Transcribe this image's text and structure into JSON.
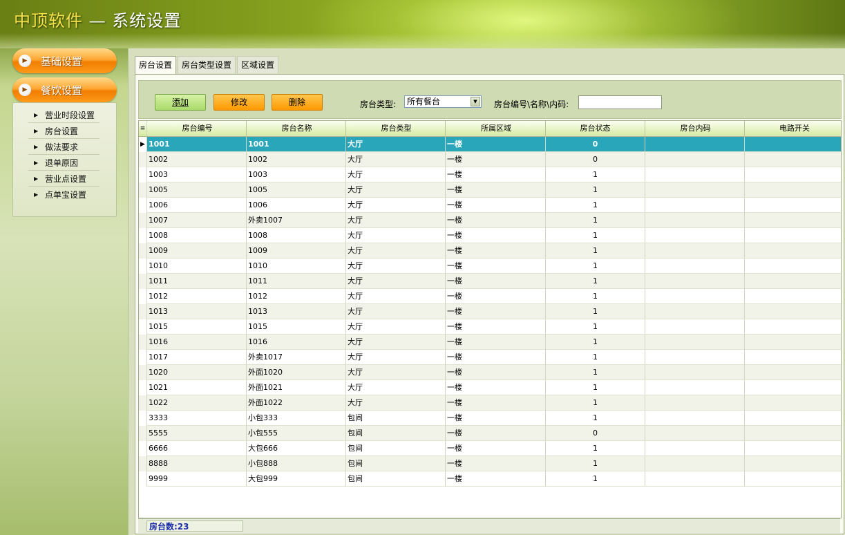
{
  "window": {
    "brand": "中顶软件",
    "title_suffix": " — 系统设置"
  },
  "sidebar": {
    "sections": [
      {
        "label": "基础设置"
      },
      {
        "label": "餐饮设置"
      }
    ],
    "items": [
      "营业时段设置",
      "房台设置",
      "做法要求",
      "退单原因",
      "营业点设置",
      "点单宝设置"
    ]
  },
  "tabs": [
    "房台设置",
    "房台类型设置",
    "区域设置"
  ],
  "toolbar": {
    "add_label": "添加",
    "edit_label": "修改",
    "delete_label": "删除",
    "type_label": "房台类型:",
    "type_value": "所有餐台",
    "search_label": "房台编号\\名称\\内码:",
    "search_value": ""
  },
  "grid": {
    "columns": [
      "房台编号",
      "房台名称",
      "房台类型",
      "所属区域",
      "房台状态",
      "房台内码",
      "电路开关"
    ],
    "rows": [
      [
        "1001",
        "1001",
        "大厅",
        "一楼",
        "0",
        "",
        ""
      ],
      [
        "1002",
        "1002",
        "大厅",
        "一楼",
        "0",
        "",
        ""
      ],
      [
        "1003",
        "1003",
        "大厅",
        "一楼",
        "1",
        "",
        ""
      ],
      [
        "1005",
        "1005",
        "大厅",
        "一楼",
        "1",
        "",
        ""
      ],
      [
        "1006",
        "1006",
        "大厅",
        "一楼",
        "1",
        "",
        ""
      ],
      [
        "1007",
        "外卖1007",
        "大厅",
        "一楼",
        "1",
        "",
        ""
      ],
      [
        "1008",
        "1008",
        "大厅",
        "一楼",
        "1",
        "",
        ""
      ],
      [
        "1009",
        "1009",
        "大厅",
        "一楼",
        "1",
        "",
        ""
      ],
      [
        "1010",
        "1010",
        "大厅",
        "一楼",
        "1",
        "",
        ""
      ],
      [
        "1011",
        "1011",
        "大厅",
        "一楼",
        "1",
        "",
        ""
      ],
      [
        "1012",
        "1012",
        "大厅",
        "一楼",
        "1",
        "",
        ""
      ],
      [
        "1013",
        "1013",
        "大厅",
        "一楼",
        "1",
        "",
        ""
      ],
      [
        "1015",
        "1015",
        "大厅",
        "一楼",
        "1",
        "",
        ""
      ],
      [
        "1016",
        "1016",
        "大厅",
        "一楼",
        "1",
        "",
        ""
      ],
      [
        "1017",
        "外卖1017",
        "大厅",
        "一楼",
        "1",
        "",
        ""
      ],
      [
        "1020",
        "外面1020",
        "大厅",
        "一楼",
        "1",
        "",
        ""
      ],
      [
        "1021",
        "外面1021",
        "大厅",
        "一楼",
        "1",
        "",
        ""
      ],
      [
        "1022",
        "外面1022",
        "大厅",
        "一楼",
        "1",
        "",
        ""
      ],
      [
        "3333",
        "小包333",
        "包间",
        "一楼",
        "1",
        "",
        ""
      ],
      [
        "5555",
        "小包555",
        "包间",
        "一楼",
        "0",
        "",
        ""
      ],
      [
        "6666",
        "大包666",
        "包间",
        "一楼",
        "1",
        "",
        ""
      ],
      [
        "8888",
        "小包888",
        "包间",
        "一楼",
        "1",
        "",
        ""
      ],
      [
        "9999",
        "大包999",
        "包间",
        "一楼",
        "1",
        "",
        ""
      ]
    ]
  },
  "status": {
    "count_text": "房台数:23"
  }
}
